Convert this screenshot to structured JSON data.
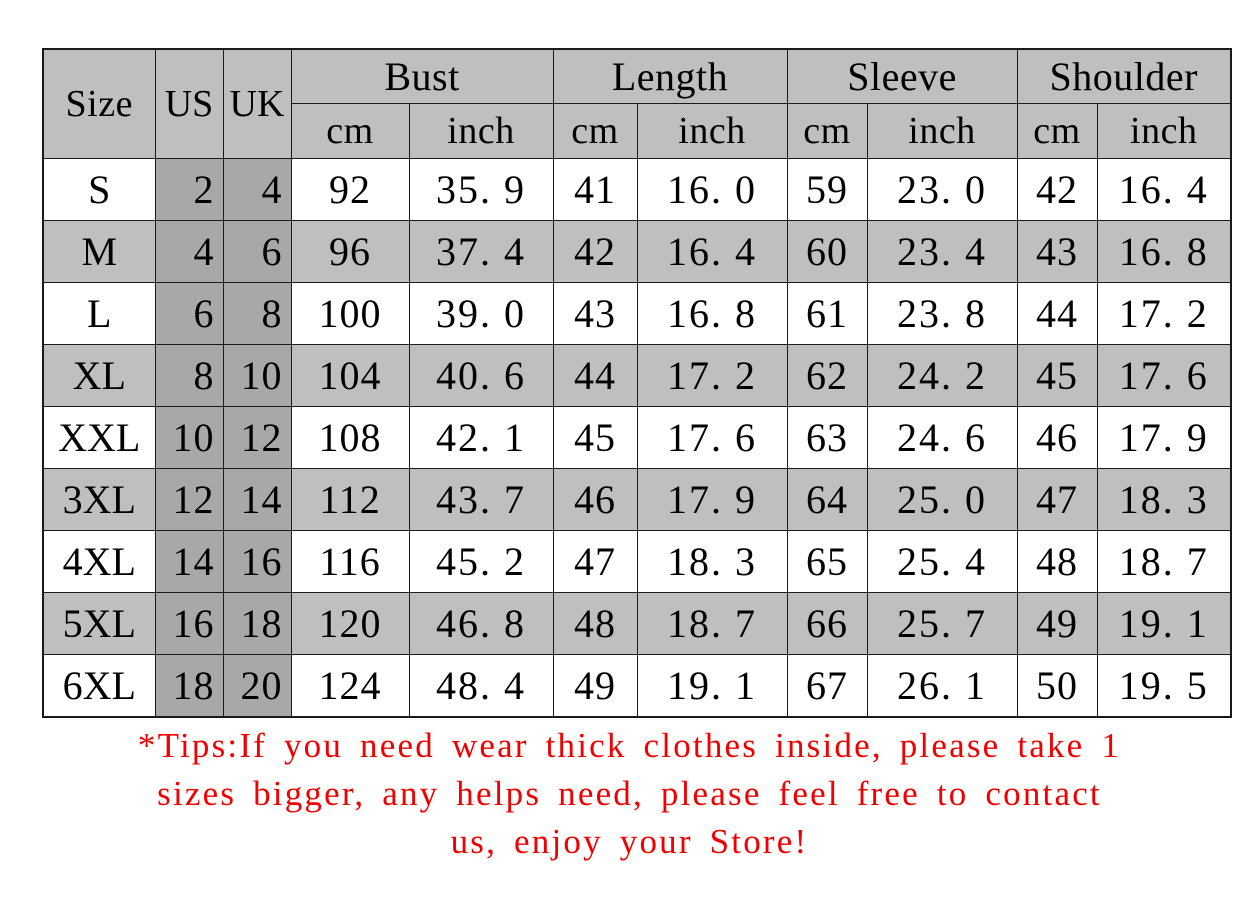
{
  "table": {
    "header": {
      "size_label": "Size",
      "us_label": "US",
      "uk_label": "UK",
      "groups": [
        {
          "label": "Bust",
          "cm": "cm",
          "inch": "inch"
        },
        {
          "label": "Length",
          "cm": "cm",
          "inch": "inch"
        },
        {
          "label": "Sleeve",
          "cm": "cm",
          "inch": "inch"
        },
        {
          "label": "Shoulder",
          "cm": "cm",
          "inch": "inch"
        }
      ]
    },
    "rows": [
      {
        "size": "S",
        "us": "2",
        "uk": "4",
        "bust_cm": "92",
        "bust_inch": "35. 9",
        "length_cm": "41",
        "length_inch": "16. 0",
        "sleeve_cm": "59",
        "sleeve_inch": "23. 0",
        "shoulder_cm": "42",
        "shoulder_inch": "16. 4"
      },
      {
        "size": "M",
        "us": "4",
        "uk": "6",
        "bust_cm": "96",
        "bust_inch": "37. 4",
        "length_cm": "42",
        "length_inch": "16. 4",
        "sleeve_cm": "60",
        "sleeve_inch": "23. 4",
        "shoulder_cm": "43",
        "shoulder_inch": "16. 8"
      },
      {
        "size": "L",
        "us": "6",
        "uk": "8",
        "bust_cm": "100",
        "bust_inch": "39. 0",
        "length_cm": "43",
        "length_inch": "16. 8",
        "sleeve_cm": "61",
        "sleeve_inch": "23. 8",
        "shoulder_cm": "44",
        "shoulder_inch": "17. 2"
      },
      {
        "size": "XL",
        "us": "8",
        "uk": "10",
        "bust_cm": "104",
        "bust_inch": "40. 6",
        "length_cm": "44",
        "length_inch": "17. 2",
        "sleeve_cm": "62",
        "sleeve_inch": "24. 2",
        "shoulder_cm": "45",
        "shoulder_inch": "17. 6"
      },
      {
        "size": "XXL",
        "us": "10",
        "uk": "12",
        "bust_cm": "108",
        "bust_inch": "42. 1",
        "length_cm": "45",
        "length_inch": "17. 6",
        "sleeve_cm": "63",
        "sleeve_inch": "24. 6",
        "shoulder_cm": "46",
        "shoulder_inch": "17. 9"
      },
      {
        "size": "3XL",
        "us": "12",
        "uk": "14",
        "bust_cm": "112",
        "bust_inch": "43. 7",
        "length_cm": "46",
        "length_inch": "17. 9",
        "sleeve_cm": "64",
        "sleeve_inch": "25. 0",
        "shoulder_cm": "47",
        "shoulder_inch": "18. 3"
      },
      {
        "size": "4XL",
        "us": "14",
        "uk": "16",
        "bust_cm": "116",
        "bust_inch": "45. 2",
        "length_cm": "47",
        "length_inch": "18. 3",
        "sleeve_cm": "65",
        "sleeve_inch": "25. 4",
        "shoulder_cm": "48",
        "shoulder_inch": "18. 7"
      },
      {
        "size": "5XL",
        "us": "16",
        "uk": "18",
        "bust_cm": "120",
        "bust_inch": "46. 8",
        "length_cm": "48",
        "length_inch": "18. 7",
        "sleeve_cm": "66",
        "sleeve_inch": "25. 7",
        "shoulder_cm": "49",
        "shoulder_inch": "19. 1"
      },
      {
        "size": "6XL",
        "us": "18",
        "uk": "20",
        "bust_cm": "124",
        "bust_inch": "48. 4",
        "length_cm": "49",
        "length_inch": "19. 1",
        "sleeve_cm": "67",
        "sleeve_inch": "26. 1",
        "shoulder_cm": "50",
        "shoulder_inch": "19. 5"
      }
    ]
  },
  "tips": {
    "lines": [
      "*Tips:If you need wear thick clothes inside, please take 1",
      "sizes bigger, any helps need, please feel free to contact",
      "us, enjoy your Store!"
    ]
  },
  "colors": {
    "header_grey": "#bfbfbf",
    "stripe_grey": "#bfbfbf",
    "us_uk_grey": "#a8a8a8",
    "row_white": "#ffffff",
    "border": "#1a1a1a",
    "tips_red": "#f00000"
  }
}
